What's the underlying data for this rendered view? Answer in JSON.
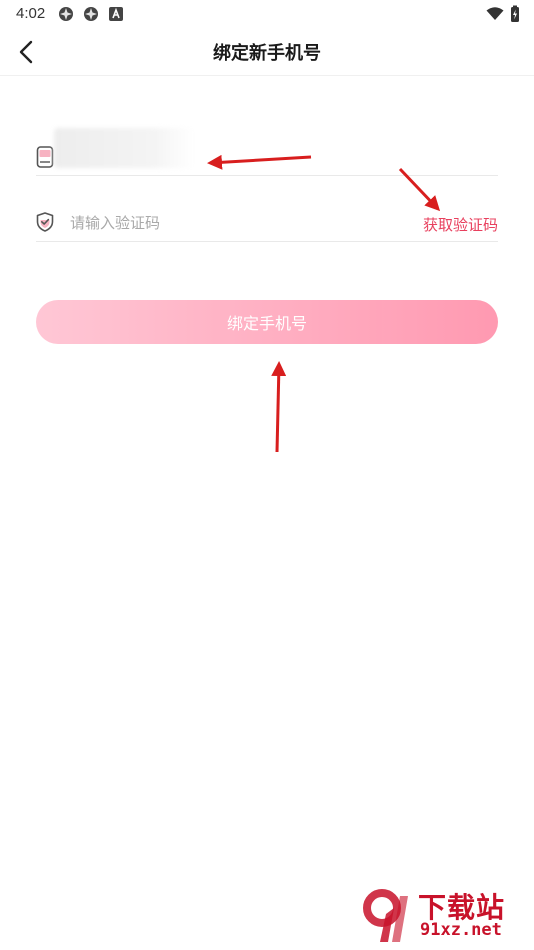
{
  "status_bar": {
    "time": "4:02",
    "icons_left": [
      "photos-icon",
      "photos-icon",
      "accessibility-icon"
    ],
    "icons_right": [
      "wifi-icon",
      "battery-charging-icon"
    ]
  },
  "header": {
    "title": "绑定新手机号",
    "back_icon": "chevron-left-icon"
  },
  "form": {
    "phone": {
      "icon": "phone-icon",
      "value_redacted": true
    },
    "code": {
      "icon": "shield-check-icon",
      "placeholder": "请输入验证码",
      "value": "",
      "get_code_label": "获取验证码"
    },
    "submit_label": "绑定手机号"
  },
  "colors": {
    "accent": "#e8405e",
    "button_gradient_start": "#ffc4d3",
    "button_gradient_end": "#ff94ad",
    "annotation_arrow": "#d81e1e"
  },
  "watermark": {
    "title": "下载站",
    "site": "91xz.net"
  }
}
